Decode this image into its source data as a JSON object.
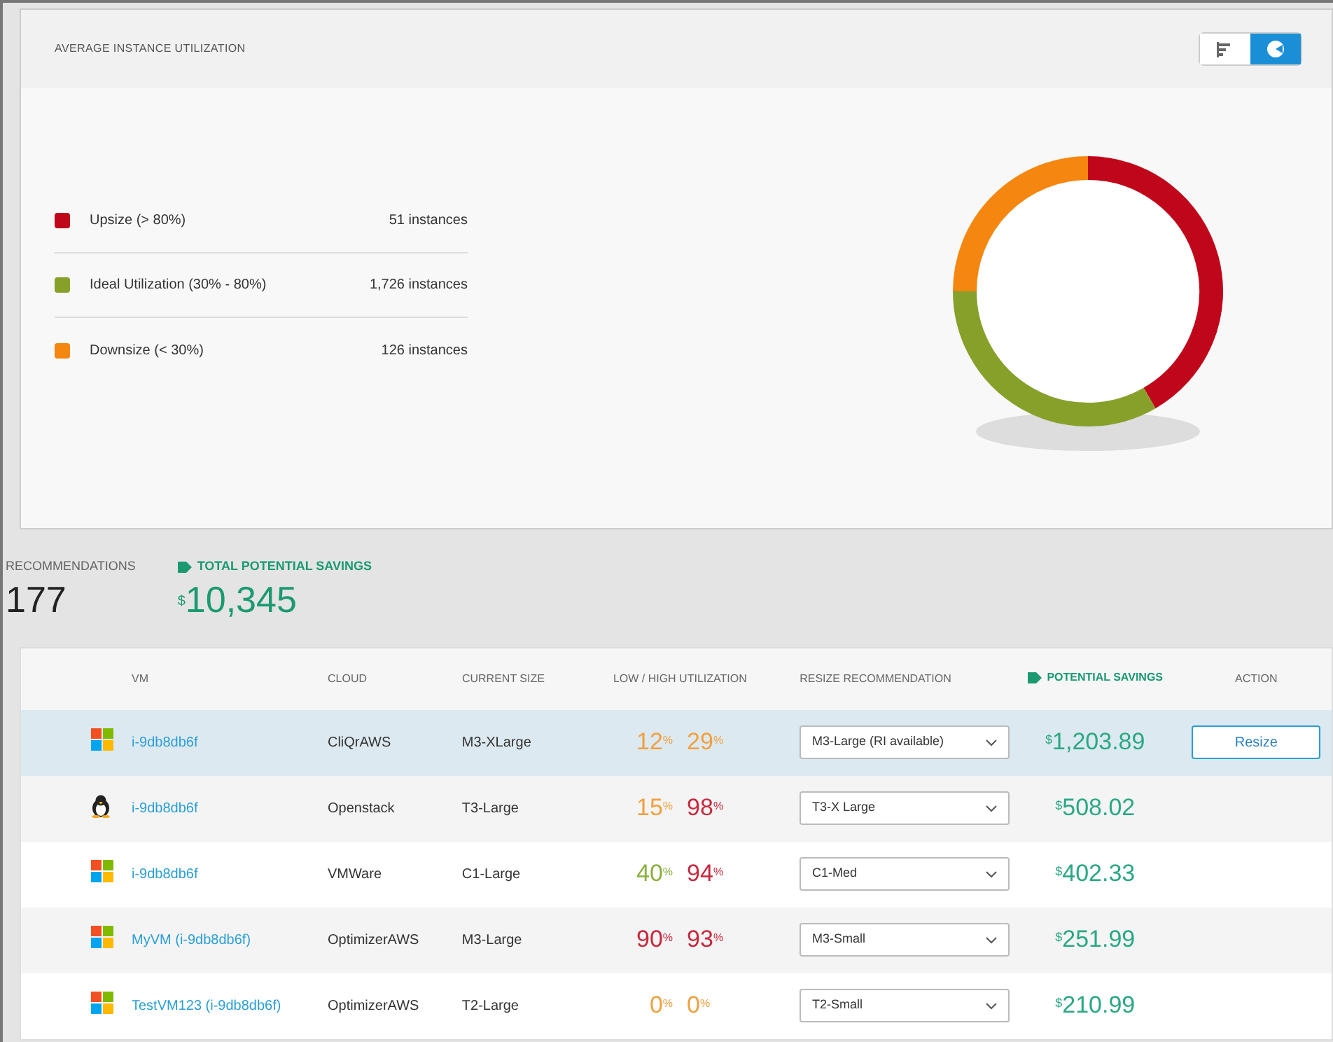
{
  "utilization_panel": {
    "title": "AVERAGE INSTANCE UTILIZATION",
    "view_toggle": [
      {
        "kind": "bar",
        "selected": false
      },
      {
        "kind": "pie",
        "selected": true
      }
    ],
    "legend": [
      {
        "label": "Upsize (> 80%)",
        "count": "51 instances",
        "color": "#c0061a"
      },
      {
        "label": "Ideal Utilization (30% - 80%)",
        "count": "1,726 instances",
        "color": "#86a02a"
      },
      {
        "label": "Downsize (< 30%)",
        "count": "126 instances",
        "color": "#f5860f"
      }
    ]
  },
  "summary": {
    "recommendations_label": "RECOMMENDATIONS",
    "recommendations_value": "177",
    "savings_label": "TOTAL POTENTIAL SAVINGS",
    "savings_currency": "$",
    "savings_value": "10,345"
  },
  "table": {
    "columns": [
      "VM",
      "CLOUD",
      "CURRENT SIZE",
      "LOW / HIGH UTILIZATION",
      "RESIZE RECOMMENDATION",
      "POTENTIAL SAVINGS",
      "ACTION"
    ],
    "rows": [
      {
        "kind": "windows",
        "vm": "i-9db8db6f",
        "cloud": "CliQrAWS",
        "size": "M3-XLarge",
        "low": {
          "value": "12",
          "unit": "%",
          "color": "#f0a040"
        },
        "high": {
          "value": "29",
          "unit": "%",
          "color": "#f0a040"
        },
        "recommendation": "M3-Large (RI available)",
        "currency": "$",
        "savings": "1,203.89",
        "action": "Resize",
        "selected": true
      },
      {
        "kind": "linux",
        "vm": "i-9db8db6f",
        "cloud": "Openstack",
        "size": "T3-Large",
        "low": {
          "value": "15",
          "unit": "%",
          "color": "#f0a040"
        },
        "high": {
          "value": "98",
          "unit": "%",
          "color": "#c8283c"
        },
        "recommendation": "T3-X Large",
        "currency": "$",
        "savings": "508.02",
        "selected": false
      },
      {
        "kind": "windows",
        "vm": "i-9db8db6f",
        "cloud": "VMWare",
        "size": "C1-Large",
        "low": {
          "value": "40",
          "unit": "%",
          "color": "#8cb040"
        },
        "high": {
          "value": "94",
          "unit": "%",
          "color": "#c8283c"
        },
        "recommendation": "C1-Med",
        "currency": "$",
        "savings": "402.33",
        "selected": false
      },
      {
        "kind": "windows",
        "vm": "MyVM (i-9db8db6f)",
        "cloud": "OptimizerAWS",
        "size": "M3-Large",
        "low": {
          "value": "90",
          "unit": "%",
          "color": "#c8283c"
        },
        "high": {
          "value": "93",
          "unit": "%",
          "color": "#c8283c"
        },
        "recommendation": "M3-Small",
        "currency": "$",
        "savings": "251.99",
        "selected": false
      },
      {
        "kind": "windows",
        "vm": "TestVM123 (i-9db8db6f)",
        "cloud": "OptimizerAWS",
        "size": "T2-Large",
        "low": {
          "value": "0",
          "unit": "%",
          "color": "#f0a040"
        },
        "high": {
          "value": "0",
          "unit": "%",
          "color": "#f0a040"
        },
        "recommendation": "T2-Small",
        "currency": "$",
        "savings": "210.99",
        "selected": false
      }
    ]
  }
}
